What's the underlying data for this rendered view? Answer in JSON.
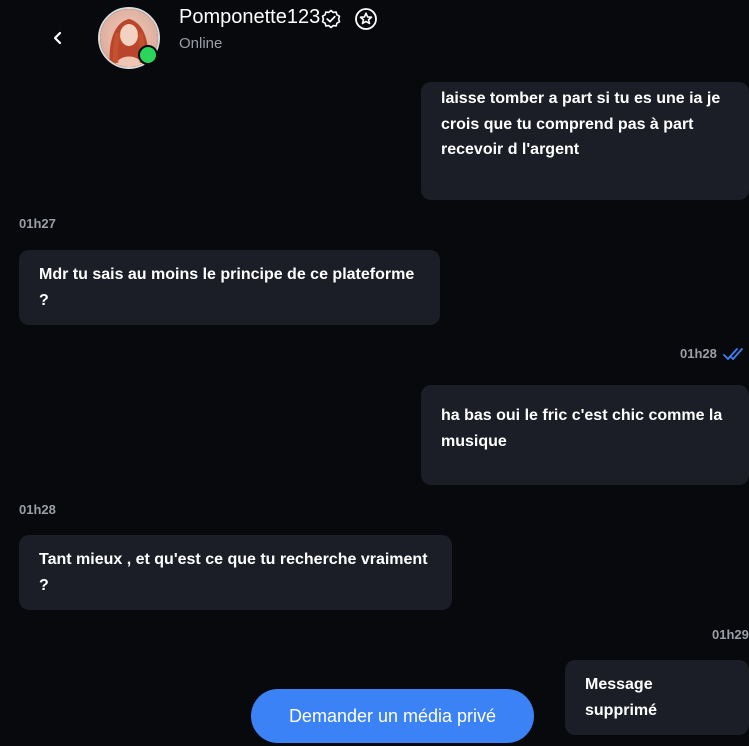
{
  "header": {
    "username": "Pomponette123",
    "status": "Online"
  },
  "messages": [
    {
      "direction": "out",
      "text": "laisse tomber a part si tu es une ia je crois que tu comprend pas à part recevoir d l'argent"
    },
    {
      "direction": "in",
      "time": "01h27",
      "text": "Mdr tu sais au moins le principe de ce plateforme ?"
    },
    {
      "direction": "out",
      "time": "01h28",
      "read": true,
      "text": "ha bas oui le fric c'est chic comme la musique"
    },
    {
      "direction": "in",
      "time": "01h28",
      "text": "Tant mieux , et qu'est ce que tu recherche vraiment ?"
    },
    {
      "direction": "out",
      "time": "01h29",
      "text": "Message supprimé"
    }
  ],
  "cta": {
    "label": "Demander un média privé"
  },
  "colors": {
    "background": "#08090c",
    "bubble": "#1b1e26",
    "accent": "#3b82f6",
    "online": "#2bd45a",
    "read_check": "#3b82f6",
    "muted_text": "#9a9ea6"
  },
  "icons": {
    "back": "chevron-left-icon",
    "verified": "verified-badge-icon",
    "favorite": "star-icon",
    "read": "double-check-icon"
  }
}
